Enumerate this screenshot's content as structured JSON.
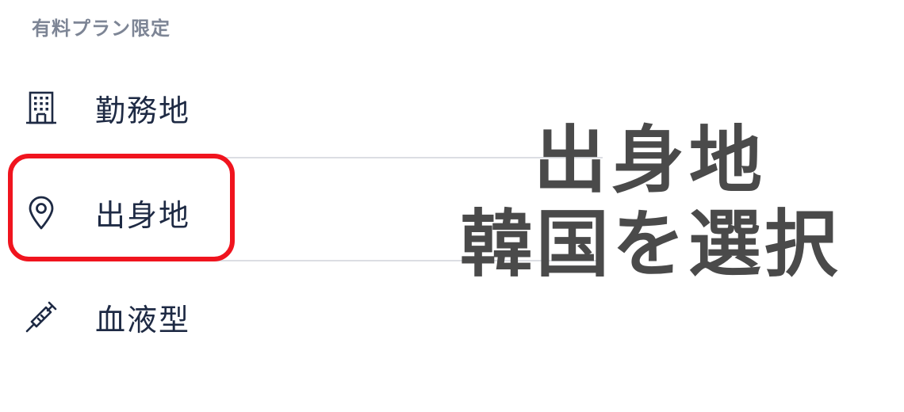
{
  "section": {
    "label": "有料プラン限定"
  },
  "menu": {
    "items": [
      {
        "label": "勤務地",
        "icon": "building-icon"
      },
      {
        "label": "出身地",
        "icon": "location-pin-icon"
      },
      {
        "label": "血液型",
        "icon": "syringe-icon"
      }
    ]
  },
  "annotation": {
    "line1": "出身地",
    "line2": "韓国を選択",
    "highlight_color": "#f0141e",
    "text_color": "#4a4a4a"
  },
  "colors": {
    "label": "#1e2a44",
    "section_label": "#7d8595",
    "divider": "#dcdee3"
  }
}
